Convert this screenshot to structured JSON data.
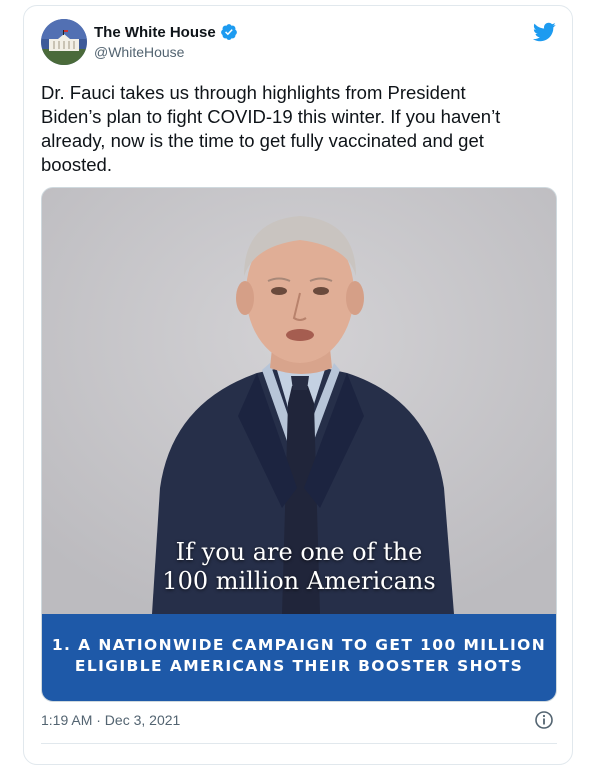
{
  "tweet": {
    "display_name": "The White House",
    "handle": "@WhiteHouse",
    "text": "Dr. Fauci takes us through highlights from President\nBiden’s plan to fight COVID-19 this winter. If you haven’t\nalready, now is the time to get fully vaccinated and get\nboosted.",
    "timestamp": "1:19 AM · Dec 3, 2021"
  },
  "media": {
    "caption_line1": "If you are one of the",
    "caption_line2": "100 million Americans",
    "banner_line1": "1. A NATIONWIDE CAMPAIGN TO GET 100 MILLION",
    "banner_line2": "ELIGIBLE AMERICANS THEIR BOOSTER SHOTS"
  },
  "icons": {
    "verified": "verified-badge-icon",
    "brand": "twitter-bird-icon",
    "info": "info-icon"
  },
  "colors": {
    "twitter_blue": "#1d9bf0",
    "banner_blue": "#1e59a8",
    "muted_text": "#536471"
  }
}
